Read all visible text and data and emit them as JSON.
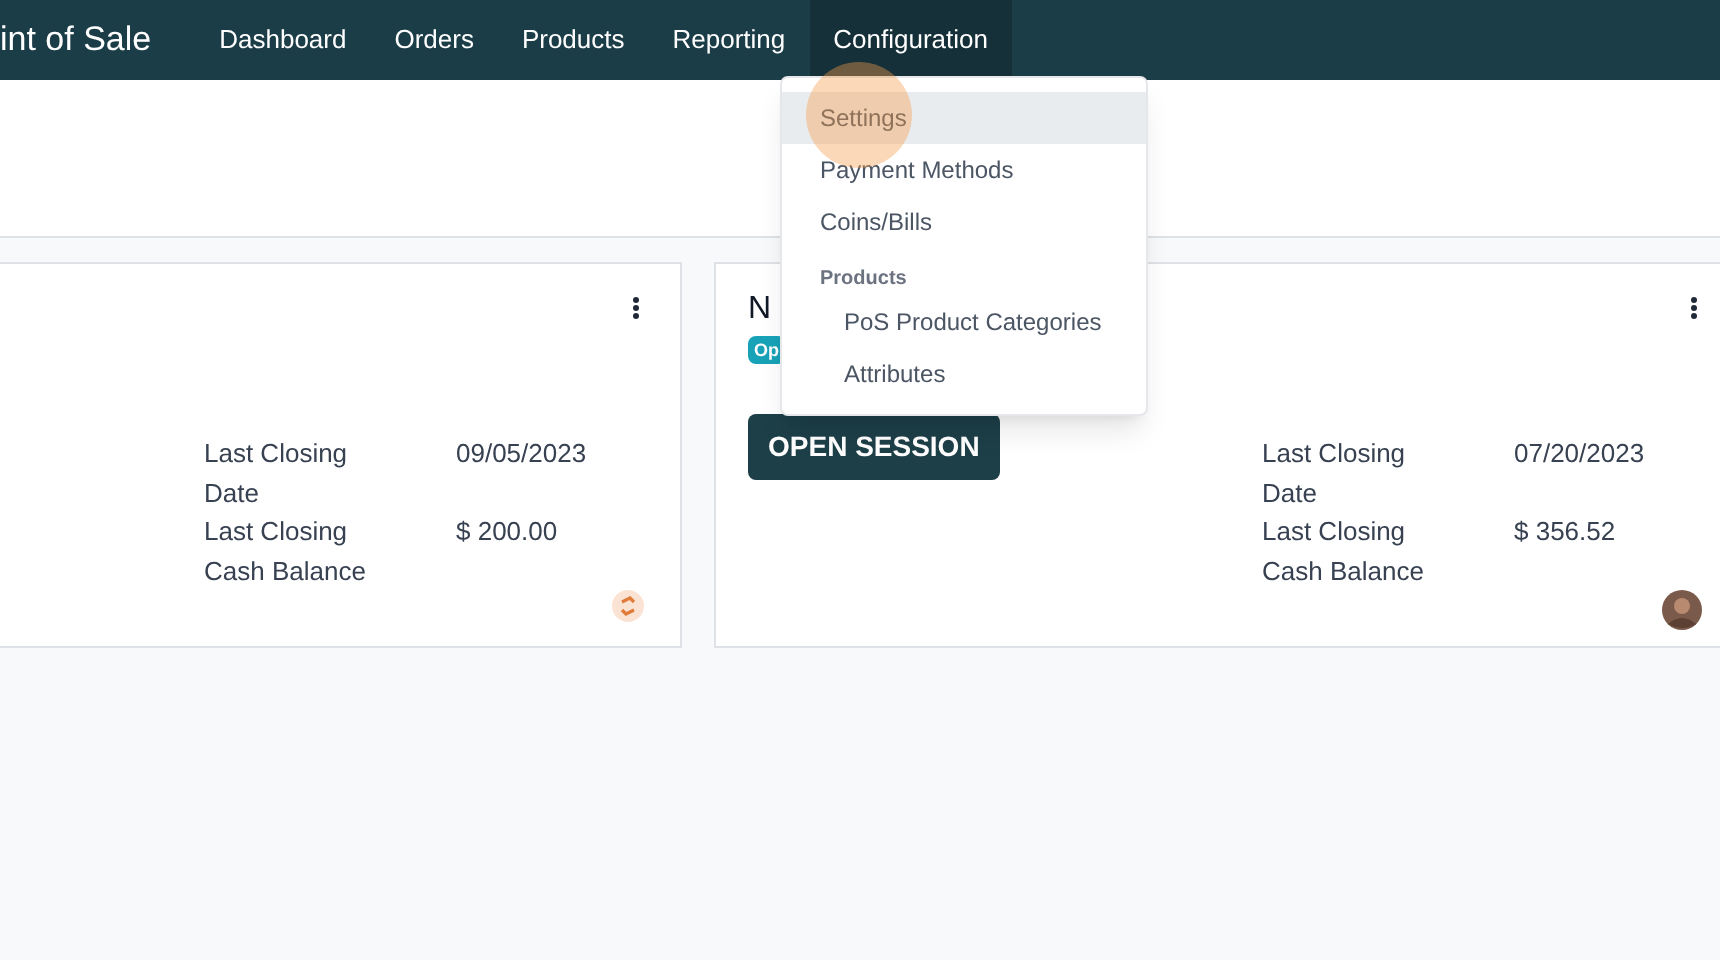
{
  "app_title": "int of Sale",
  "nav": [
    {
      "label": "Dashboard",
      "selected": false
    },
    {
      "label": "Orders",
      "selected": false
    },
    {
      "label": "Products",
      "selected": false
    },
    {
      "label": "Reporting",
      "selected": false
    },
    {
      "label": "Configuration",
      "selected": true
    }
  ],
  "menu": [
    {
      "kind": "item",
      "label": "Settings",
      "selected": true
    },
    {
      "kind": "item",
      "label": "Payment Methods",
      "selected": false
    },
    {
      "kind": "item",
      "label": "Coins/Bills",
      "selected": false
    },
    {
      "kind": "header",
      "label": "Products"
    },
    {
      "kind": "subitem",
      "label": "PoS Product Categories",
      "selected": false
    },
    {
      "kind": "subitem",
      "label": "Attributes",
      "selected": false
    }
  ],
  "cards": [
    {
      "stats": [
        {
          "label": "Last Closing Date",
          "value": "09/05/2023"
        },
        {
          "label": "Last Closing Cash Balance",
          "value": "$ 200.00"
        }
      ],
      "owner": {
        "kind": "logo"
      }
    },
    {
      "title": "N",
      "status": "Op",
      "button": "OPEN SESSION",
      "stats": [
        {
          "label": "Last Closing Date",
          "value": "07/20/2023"
        },
        {
          "label": "Last Closing Cash Balance",
          "value": "$ 356.52"
        }
      ],
      "owner": {
        "kind": "avatar"
      }
    }
  ]
}
